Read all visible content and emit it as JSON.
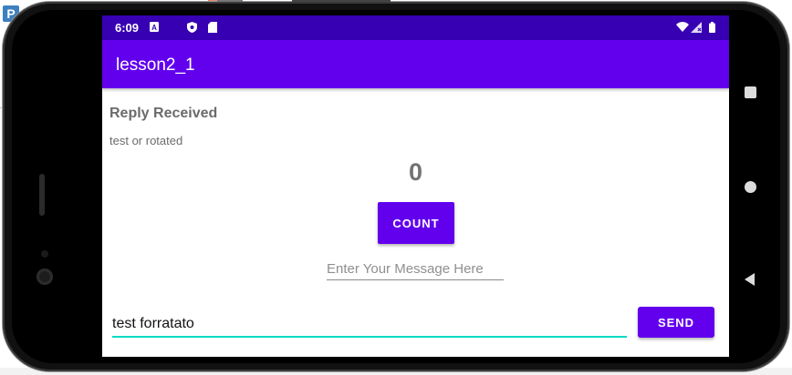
{
  "statusbar": {
    "time": "6:09",
    "icons": [
      "a-notification-icon",
      "shield-icon",
      "sd-card-icon",
      "wifi-icon",
      "cell-signal-icon",
      "battery-icon"
    ]
  },
  "app": {
    "title": "lesson2_1"
  },
  "main": {
    "reply_heading": "Reply Received",
    "reply_text": "test or rotated",
    "count": "0",
    "count_button": "COUNT",
    "message_placeholder": "Enter Your Message Here",
    "edit_value": "test forratato",
    "send_button": "SEND"
  },
  "colors": {
    "status_bar": "#3700b3",
    "app_bar": "#6200ee",
    "accent": "#03dac5"
  }
}
